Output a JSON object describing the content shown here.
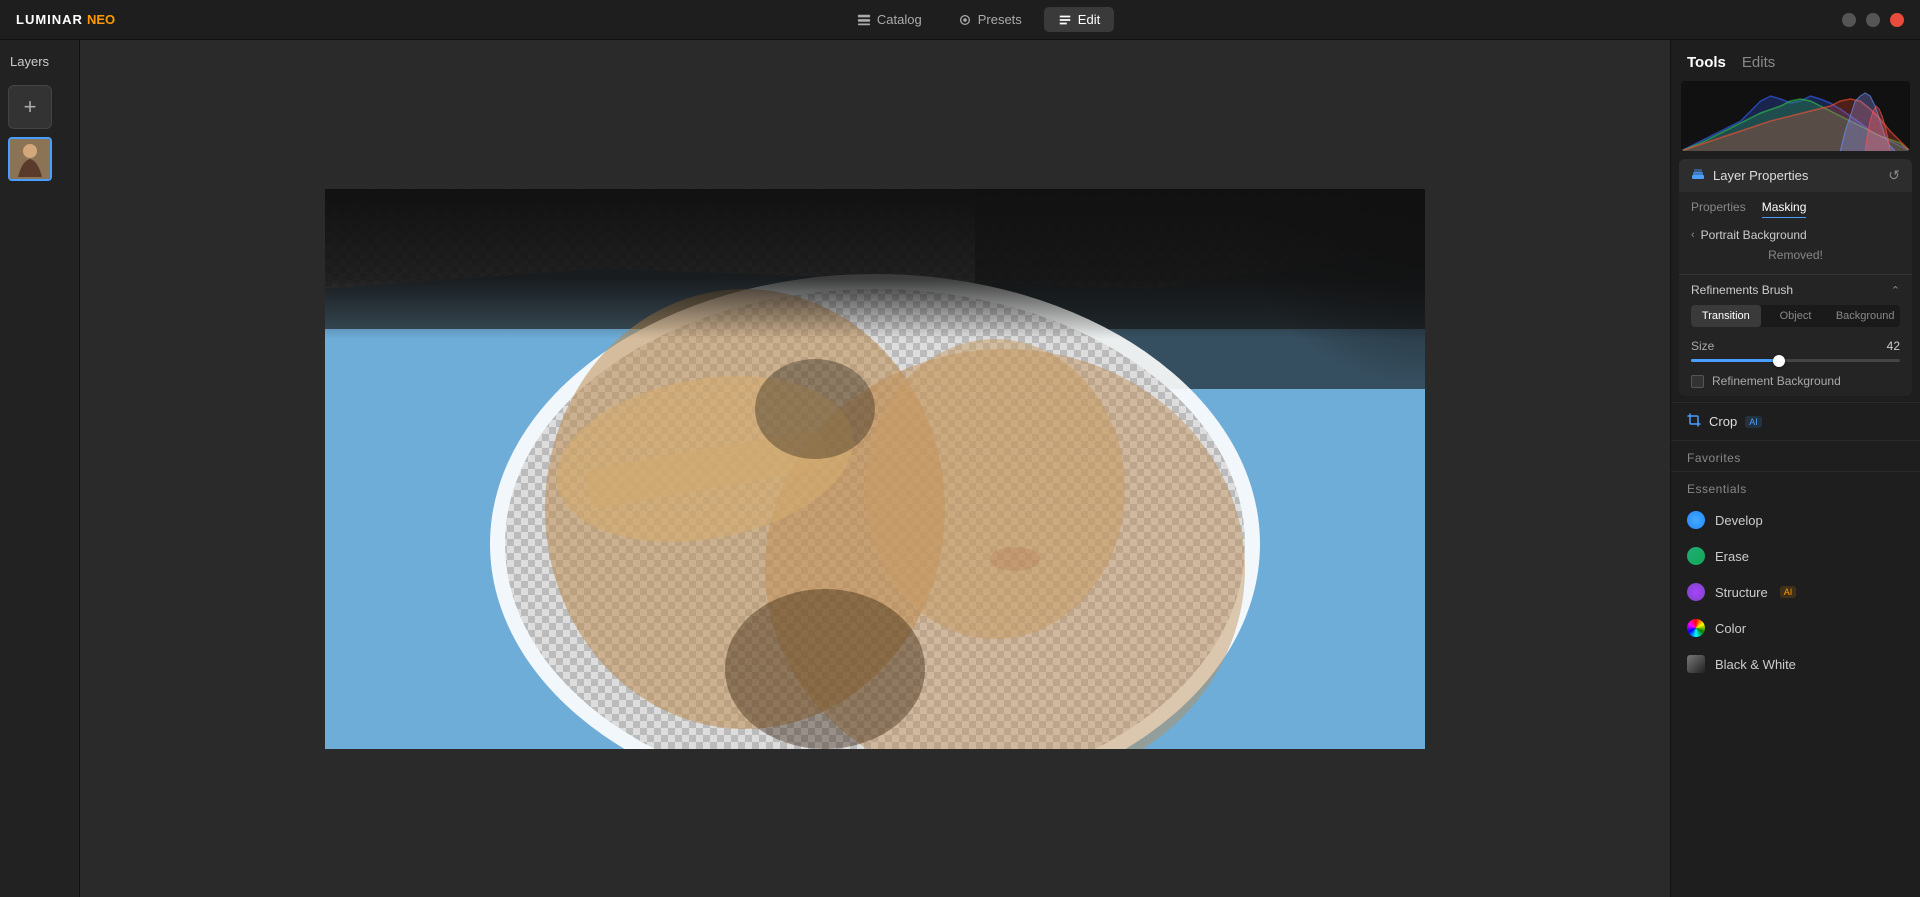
{
  "app": {
    "name": "LUMINAR",
    "version": "NEO"
  },
  "titlebar": {
    "nav": {
      "catalog_label": "Catalog",
      "presets_label": "Presets",
      "edit_label": "Edit"
    },
    "controls": {
      "minimize": "−",
      "maximize": "⧠",
      "close": "✕"
    }
  },
  "layers": {
    "title": "Layers",
    "add_btn": "+",
    "items": [
      {
        "id": "layer-1",
        "active": true
      }
    ]
  },
  "right_panel": {
    "tools_label": "Tools",
    "edits_label": "Edits",
    "layer_properties": {
      "title": "Layer Properties",
      "tabs": {
        "properties_label": "Properties",
        "masking_label": "Masking"
      },
      "portrait_bg": {
        "title": "Portrait Background",
        "status": "Removed!"
      },
      "refinements": {
        "title": "Refinements Brush",
        "tabs": {
          "transition_label": "Transition",
          "object_label": "Object",
          "background_label": "Background"
        },
        "size_label": "Size",
        "size_value": "42",
        "slider_percent": 42,
        "refine_bg_label": "Refinement Background"
      }
    },
    "crop": {
      "label": "Crop",
      "ai": "AI"
    },
    "favorites_label": "Favorites",
    "essentials_label": "Essentials",
    "tools": [
      {
        "id": "develop",
        "label": "Develop",
        "icon_type": "develop",
        "ai": false
      },
      {
        "id": "erase",
        "label": "Erase",
        "icon_type": "erase",
        "ai": false
      },
      {
        "id": "structure",
        "label": "Structure",
        "icon_type": "structure",
        "ai": true
      },
      {
        "id": "color",
        "label": "Color",
        "icon_type": "color",
        "ai": false
      },
      {
        "id": "bw",
        "label": "Black & White",
        "icon_type": "bw",
        "ai": false
      }
    ]
  }
}
